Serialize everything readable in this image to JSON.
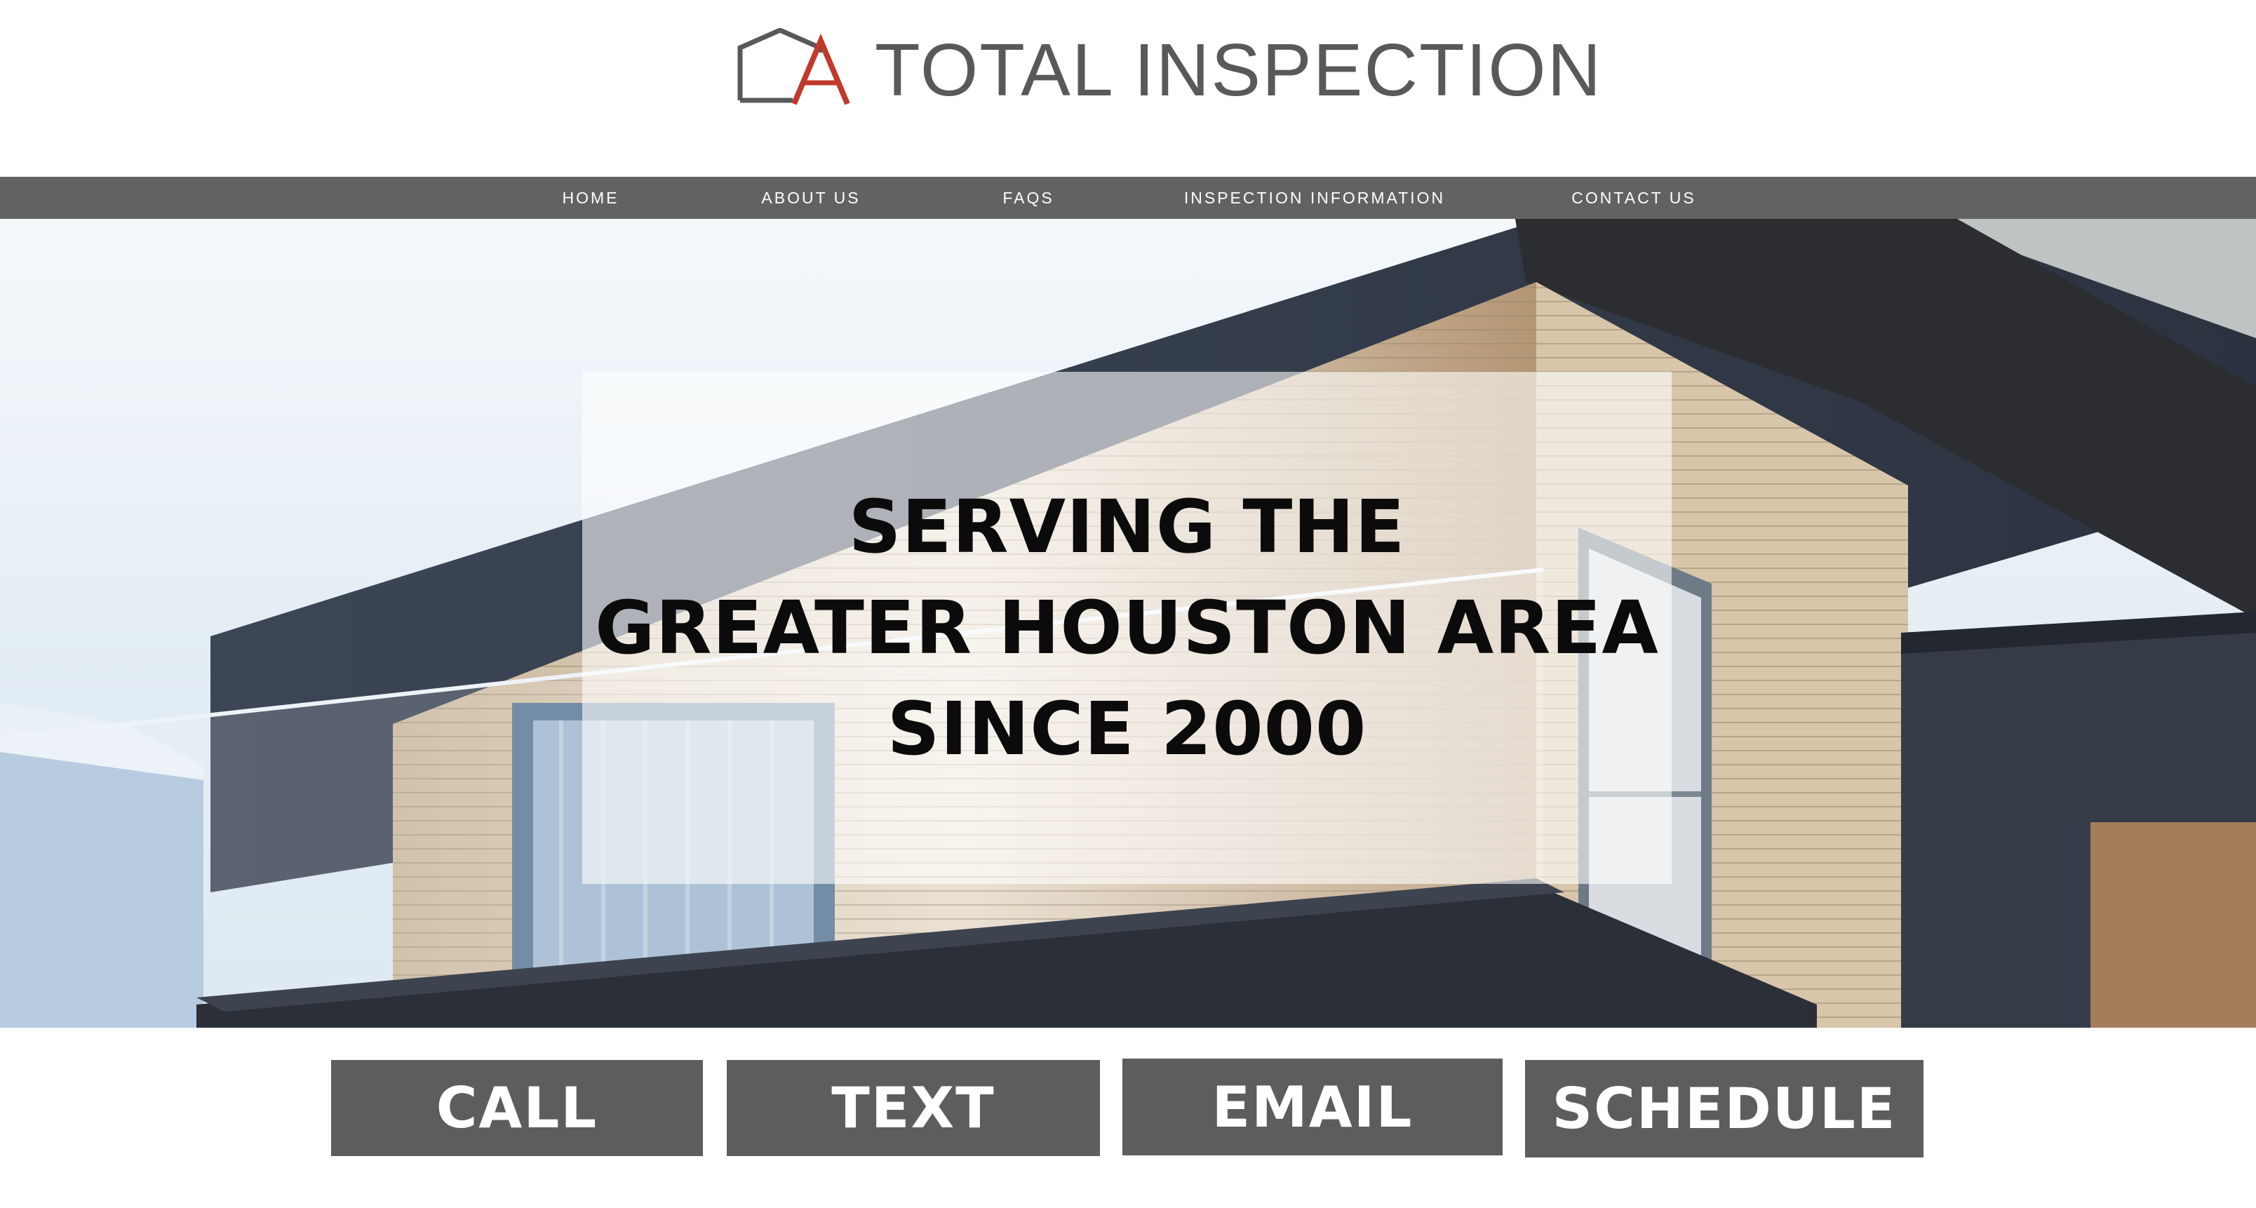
{
  "brand": {
    "name": "TOTAL INSPECTION",
    "logo_icon": "house-outline-logo",
    "colors": {
      "text": "#58595b",
      "accent": "#c0392b"
    }
  },
  "nav": {
    "items": [
      {
        "label": "HOME"
      },
      {
        "label": "ABOUT US"
      },
      {
        "label": "FAQS"
      },
      {
        "label": "INSPECTION INFORMATION"
      },
      {
        "label": "CONTACT US"
      }
    ],
    "background": "#626262"
  },
  "hero": {
    "lines": [
      "SERVING THE",
      "GREATER HOUSTON AREA",
      "SINCE 2000"
    ],
    "image": "modern-house-photo"
  },
  "cta": {
    "call": "CALL",
    "text": "TEXT",
    "email": "EMAIL",
    "schedule": "SCHEDULE",
    "background": "#5d5d5d"
  }
}
